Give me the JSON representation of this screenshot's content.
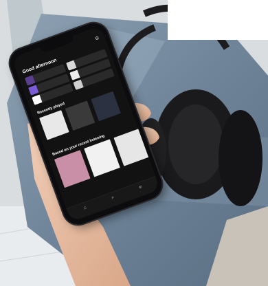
{
  "screen": {
    "section_good": "Good afternoon",
    "section_recent": "Recently played",
    "section_based": "Based on your recent listening"
  },
  "icons": [
    "gear-icon",
    "home-icon",
    "search-icon",
    "library-icon"
  ]
}
